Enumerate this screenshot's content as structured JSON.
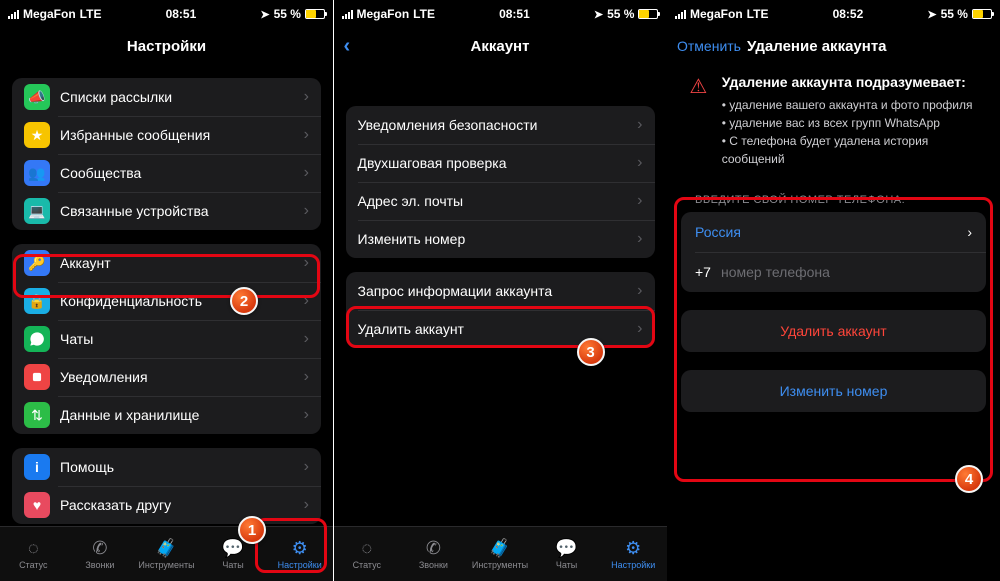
{
  "status": {
    "carrier": "MegaFon",
    "network": "LTE",
    "time1": "08:51",
    "time2": "08:51",
    "time3": "08:52",
    "battery": "55 %"
  },
  "steps": {
    "s1": "1",
    "s2": "2",
    "s3": "3",
    "s4": "4"
  },
  "phone1": {
    "title": "Настройки",
    "rows": {
      "broadcast": "Списки рассылки",
      "starred": "Избранные сообщения",
      "communities": "Сообщества",
      "linked": "Связанные устройства",
      "account": "Аккаунт",
      "privacy": "Конфиденциальность",
      "chats": "Чаты",
      "notifications": "Уведомления",
      "storage": "Данные и хранилище",
      "help": "Помощь",
      "tell": "Рассказать другу"
    }
  },
  "phone2": {
    "title": "Аккаунт",
    "rows": {
      "security": "Уведомления безопасности",
      "twostep": "Двухшаговая проверка",
      "email": "Адрес эл. почты",
      "changenum": "Изменить номер",
      "request": "Запрос информации аккаунта",
      "delete": "Удалить аккаунт"
    }
  },
  "phone3": {
    "cancel": "Отменить",
    "title": "Удаление аккаунта",
    "warn_title": "Удаление аккаунта подразумевает:",
    "warn1": "удаление вашего аккаунта и фото профиля",
    "warn2": "удаление вас из всех групп WhatsApp",
    "warn3": "С телефона будет удалена история сообщений",
    "section": "ВВЕДИТЕ СВОЙ НОМЕР ТЕЛЕФОНА:",
    "country": "Россия",
    "prefix": "+7",
    "placeholder": "номер телефона",
    "btn_delete": "Удалить аккаунт",
    "btn_change": "Изменить номер"
  },
  "tabs": {
    "status": "Статус",
    "calls": "Звонки",
    "tools": "Инструменты",
    "chats": "Чаты",
    "settings": "Настройки"
  }
}
